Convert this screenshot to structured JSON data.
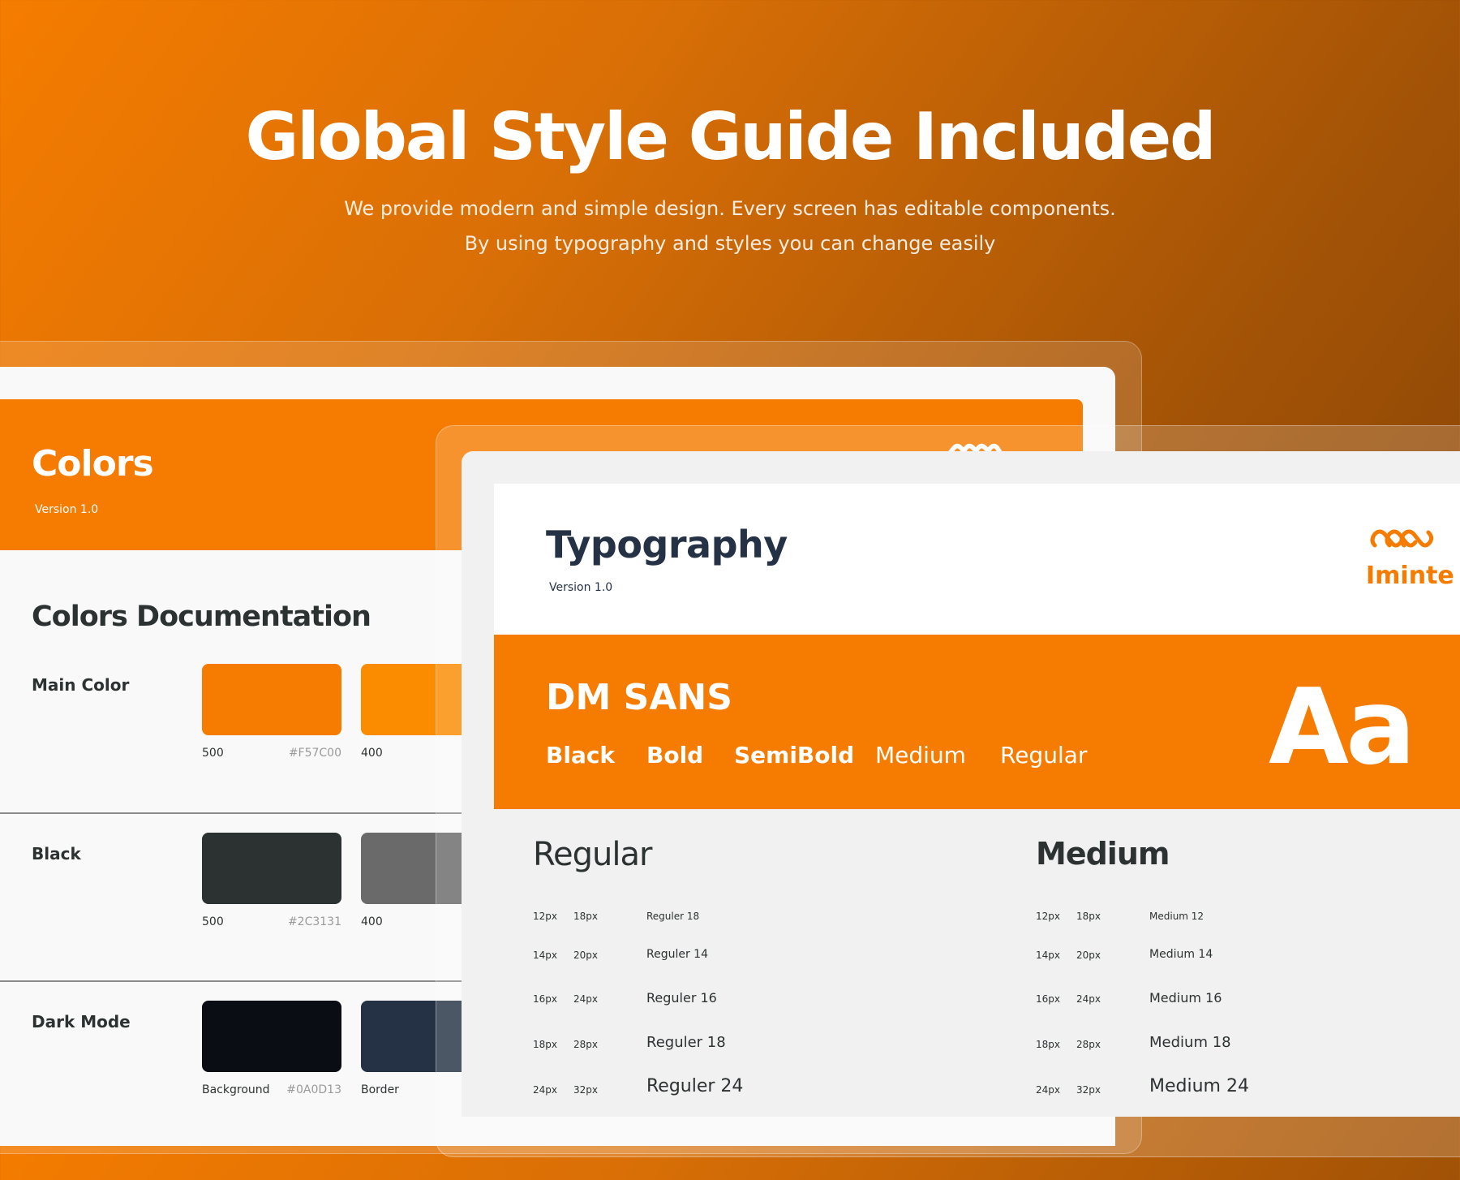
{
  "hero": {
    "title": "Global Style Guide Included",
    "subtitle_line1": "We provide modern and simple design. Every screen has editable components.",
    "subtitle_line2": "By using typography and styles you can change easily"
  },
  "colors_card": {
    "title": "Colors",
    "version": "Version 1.0",
    "doc_title": "Colors Documentation",
    "rows": [
      {
        "label": "Main Color",
        "swatches": [
          {
            "name": "500",
            "hex": "#F57C00",
            "color": "#f57c00"
          },
          {
            "name": "400",
            "hex": "",
            "color": "#fb8c00"
          }
        ]
      },
      {
        "label": "Black",
        "swatches": [
          {
            "name": "500",
            "hex": "#2C3131",
            "color": "#2c3131"
          },
          {
            "name": "400",
            "hex": "",
            "color": "#6a6a6a"
          }
        ]
      },
      {
        "label": "Dark Mode",
        "swatches": [
          {
            "name": "Background",
            "hex": "#0A0D13",
            "color": "#0a0d13"
          },
          {
            "name": "Border",
            "hex": "",
            "color": "#253245"
          }
        ]
      }
    ]
  },
  "typography_card": {
    "title": "Typography",
    "version": "Version 1.0",
    "brand_name": "Iminte",
    "font_name": "DM SANS",
    "weights": [
      "Black",
      "Bold",
      "SemiBold",
      "Medium",
      "Regular"
    ],
    "sample_glyph": "Aa",
    "columns": [
      {
        "heading": "Regular",
        "rows": [
          {
            "size": "12px",
            "line_height": "18px",
            "sample": "Reguler 18"
          },
          {
            "size": "14px",
            "line_height": "20px",
            "sample": "Reguler 14"
          },
          {
            "size": "16px",
            "line_height": "24px",
            "sample": "Reguler 16"
          },
          {
            "size": "18px",
            "line_height": "28px",
            "sample": "Reguler 18"
          },
          {
            "size": "24px",
            "line_height": "32px",
            "sample": "Reguler 24"
          }
        ]
      },
      {
        "heading": "Medium",
        "rows": [
          {
            "size": "12px",
            "line_height": "18px",
            "sample": "Medium 12"
          },
          {
            "size": "14px",
            "line_height": "20px",
            "sample": "Medium 14"
          },
          {
            "size": "16px",
            "line_height": "24px",
            "sample": "Medium 16"
          },
          {
            "size": "18px",
            "line_height": "28px",
            "sample": "Medium 18"
          },
          {
            "size": "24px",
            "line_height": "32px",
            "sample": "Medium 24"
          }
        ]
      }
    ]
  },
  "colors": {
    "brand_orange": "#f57c00",
    "heading_navy": "#253245",
    "text_dark": "#2c3131"
  },
  "icons": {
    "brand_logo": "infinity-chain-logo-icon"
  }
}
